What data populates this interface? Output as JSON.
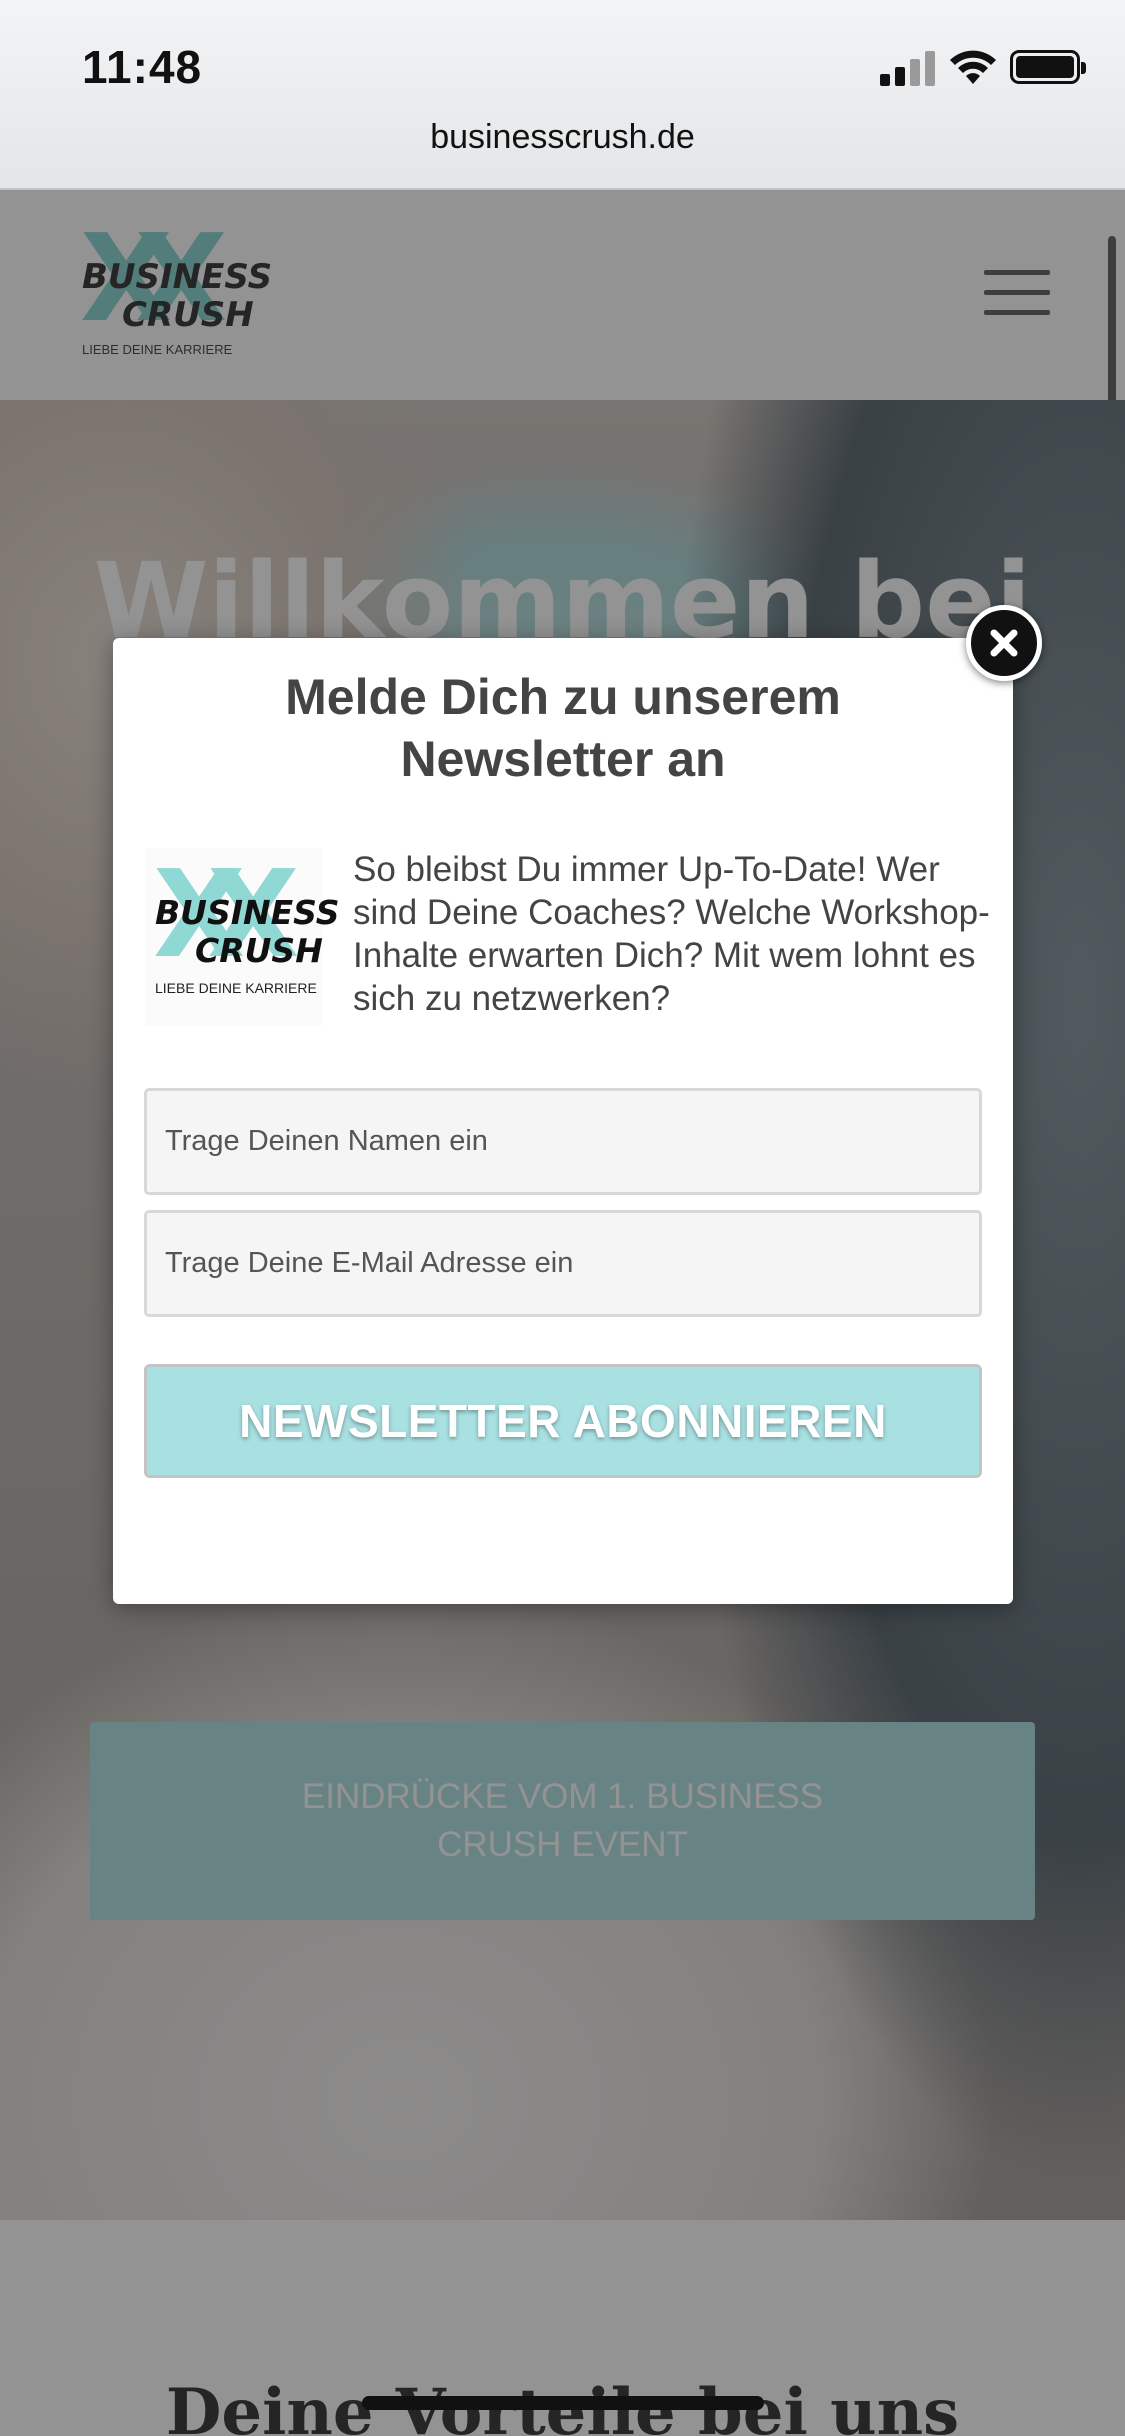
{
  "status_bar": {
    "time": "11:48",
    "signal_icon": "cellular-signal-icon",
    "wifi_icon": "wifi-icon",
    "battery_icon": "battery-icon"
  },
  "browser": {
    "url": "businesscrush.de"
  },
  "site_header": {
    "logo": {
      "line1": "BUSINESS",
      "line2": "CRUSH",
      "tagline": "LIEBE DEINE KARRIERE"
    },
    "menu_icon": "hamburger-menu-icon"
  },
  "hero": {
    "title": "Willkommen bei",
    "cta_label": "EINDRÜCKE VOM 1. BUSINESS CRUSH EVENT"
  },
  "section2": {
    "title": "Deine Vorteile bei uns"
  },
  "modal": {
    "title": "Melde Dich zu unserem Newsletter an",
    "logo": {
      "line1": "BUSINESS",
      "line2": "CRUSH",
      "tagline": "LIEBE DEINE KARRIERE"
    },
    "description": "So bleibst Du immer Up-To-Date! Wer sind Deine Coaches? Welche Workshop-Inhalte erwarten Dich? Mit wem lohnt es sich zu netzwerken?",
    "name_placeholder": "Trage Deinen Namen ein",
    "email_placeholder": "Trage Deine E-Mail Adresse ein",
    "subscribe_label": "NEWSLETTER ABONNIEREN",
    "close_icon": "close-icon"
  },
  "colors": {
    "accent": "#a9e1e3",
    "text": "#444444",
    "overlay": "rgba(40,40,40,0.5)"
  }
}
